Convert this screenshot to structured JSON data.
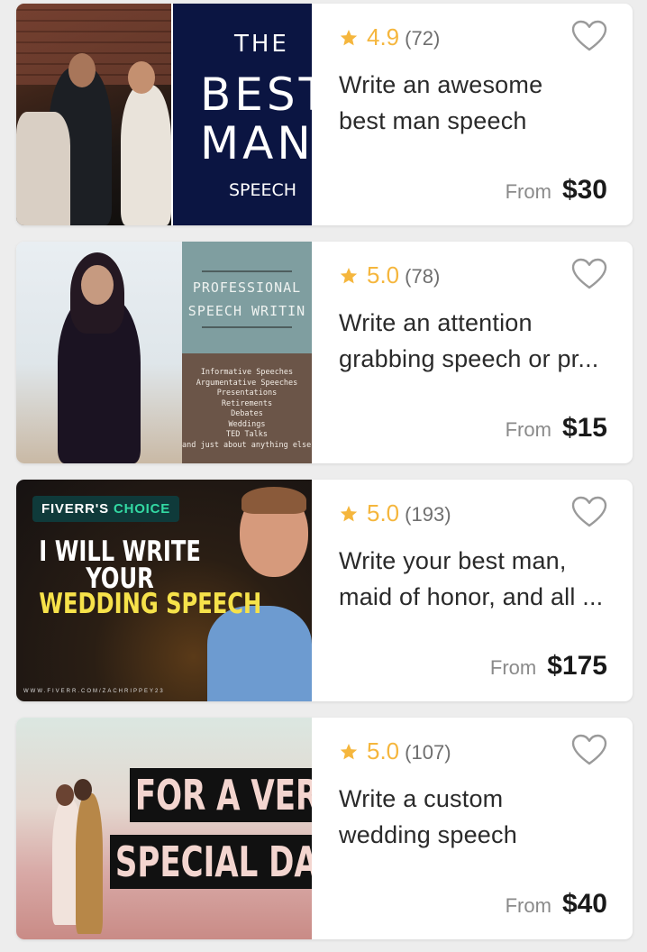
{
  "colors": {
    "background": "#ededed",
    "card": "#ffffff",
    "rating": "#f5b63d",
    "muted": "#8a8a8a",
    "price": "#1a1a1a"
  },
  "icons": {
    "rating": "star-icon",
    "save": "heart-outline-icon"
  },
  "gigs": [
    {
      "rating": "4.9",
      "reviews": "(72)",
      "title_lines": [
        "Write an awesome",
        "best man speech"
      ],
      "from": "From",
      "price": "$30",
      "thumb": {
        "the": "THE",
        "line1": "BEST",
        "line2": "MAN",
        "sub": "SPEECH"
      }
    },
    {
      "rating": "5.0",
      "reviews": "(78)",
      "title_lines": [
        "Write an attention",
        "grabbing speech or pr..."
      ],
      "from": "From",
      "price": "$15",
      "thumb": {
        "heading1": "PROFESSIONAL",
        "heading2": "SPEECH WRITIN",
        "items": [
          "Informative Speeches",
          "Argumentative Speeches",
          "Presentations",
          "Retirements",
          "Debates",
          "Weddings",
          "TED Talks",
          "and just about anything else.."
        ]
      }
    },
    {
      "rating": "5.0",
      "reviews": "(193)",
      "title_lines": [
        "Write your best man,",
        "maid of honor, and all ..."
      ],
      "from": "From",
      "price": "$175",
      "thumb": {
        "badge_a": "FIVERR'S ",
        "badge_b": "CHOICE",
        "line1": "I WILL WRITE",
        "line2": "YOUR",
        "line3": "WEDDING SPEECH",
        "url": "WWW.FIVERR.COM/ZACHRIPPEY23"
      }
    },
    {
      "rating": "5.0",
      "reviews": "(107)",
      "title_lines": [
        "Write a custom",
        "wedding speech"
      ],
      "from": "From",
      "price": "$40",
      "thumb": {
        "line1": "FOR A VERY",
        "line2": "SPECIAL DAY"
      }
    }
  ]
}
